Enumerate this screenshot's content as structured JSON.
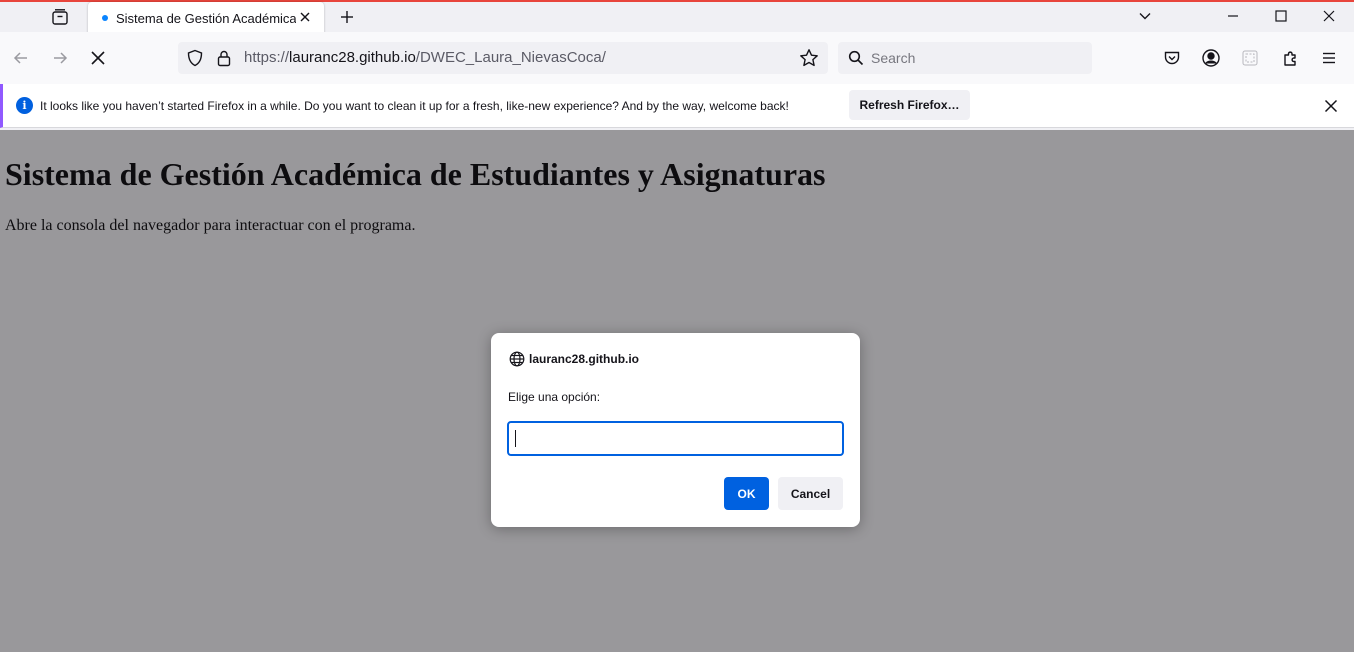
{
  "tab": {
    "title": "Sistema de Gestión Académica"
  },
  "navbar": {
    "url_host": "lauranc28.github.io",
    "url_prefix": "https://",
    "url_path": "/DWEC_Laura_NievasCoca/",
    "search_placeholder": "Search"
  },
  "notification": {
    "message": "It looks like you haven’t started Firefox in a while. Do you want to clean it up for a fresh, like-new experience? And by the way, welcome back!",
    "button_label": "Refresh Firefox…"
  },
  "page": {
    "heading": "Sistema de Gestión Académica de Estudiantes y Asignaturas",
    "paragraph": "Abre la consola del navegador para interactuar con el programa."
  },
  "dialog": {
    "origin": "lauranc28.github.io",
    "message": "Elige una opción:",
    "input_value": "",
    "ok_label": "OK",
    "cancel_label": "Cancel"
  },
  "icons": {
    "tab_overview": "tab-overview-icon",
    "tab_close": "close-icon",
    "new_tab": "plus-icon",
    "list_tabs": "chevron-down-icon",
    "minimize": "minimize-icon",
    "maximize": "maximize-icon",
    "window_close": "close-icon",
    "back": "arrow-left-icon",
    "forward": "arrow-right-icon",
    "stop": "stop-icon",
    "tracking_protection": "shield-icon",
    "lock": "lock-icon",
    "bookmark": "star-icon",
    "search": "search-icon",
    "pocket": "pocket-icon",
    "account": "account-icon",
    "extension_placeholder": "extension-icon",
    "extensions": "puzzle-icon",
    "menu": "hamburger-icon",
    "info": "info-icon",
    "globe": "globe-icon"
  },
  "colors": {
    "accent": "#0061e0",
    "window_top_border": "#e8453c",
    "notification_accent": "#9059ff",
    "overlay": "rgba(28,27,34,0.45)"
  }
}
